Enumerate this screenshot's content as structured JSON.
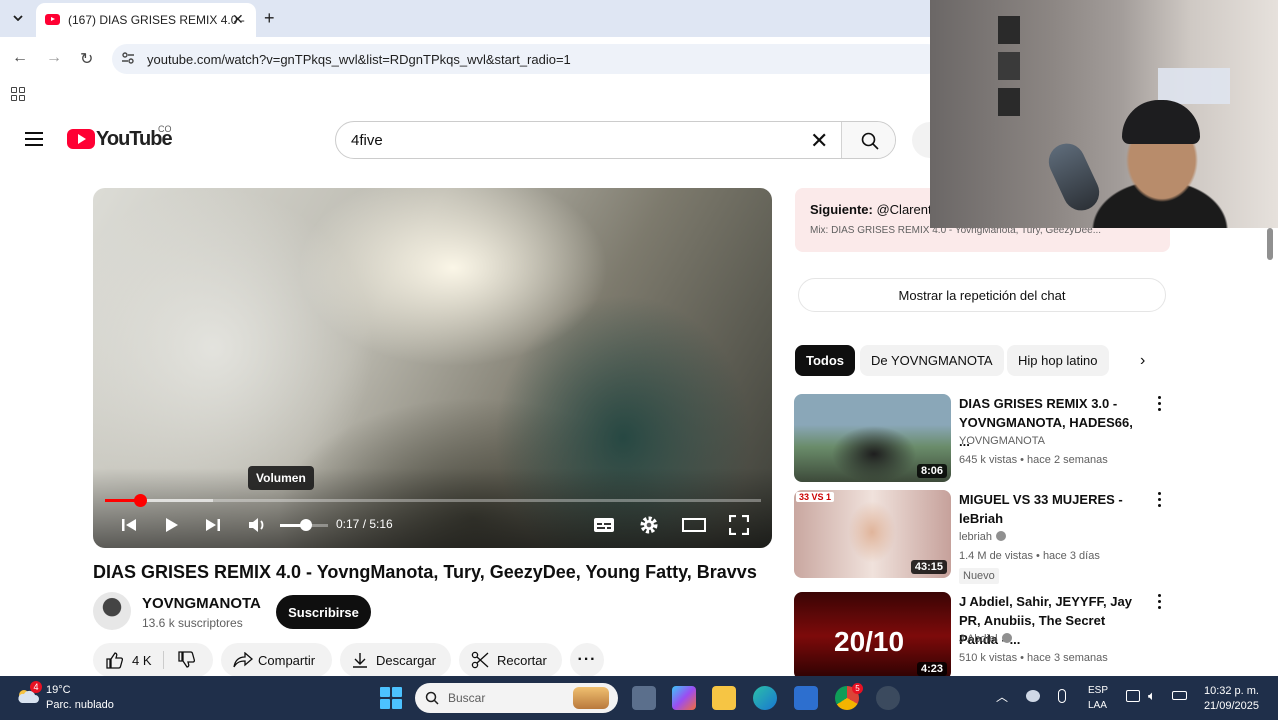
{
  "browser": {
    "tab_title": "(167) DIAS GRISES REMIX 4.0 -",
    "url": "youtube.com/watch?v=gnTPkqs_wvl&list=RDgnTPkqs_wvl&start_radio=1"
  },
  "youtube": {
    "logo_text": "YouTube",
    "country_code": "CO",
    "search_query": "4five"
  },
  "player": {
    "tooltip": "Volumen",
    "current_time": "0:17",
    "duration": "5:16",
    "time_display": "0:17 / 5:16",
    "progress_fraction": 0.054,
    "buffered_fraction": 0.165,
    "volume_fraction": 0.55
  },
  "video": {
    "title": "DIAS GRISES REMIX 4.0 - YovngManota, Tury, GeezyDee, Young Fatty, Bravvs",
    "channel_name": "YOVNGMANOTA",
    "subscribers": "13.6 k suscriptores",
    "subscribe_label": "Suscribirse",
    "likes": "4 K",
    "share_label": "Compartir",
    "download_label": "Descargar",
    "clip_label": "Recortar"
  },
  "sidebar": {
    "next_up_label": "Siguiente:",
    "next_up_channel": "@ClarentK",
    "next_up_mix": "Mix: DIAS GRISES REMIX 4.0 - YovngManota, Tury, GeezyDee...",
    "chat_replay_label": "Mostrar la repetición del chat",
    "chips": [
      "Todos",
      "De YOVNGMANOTA",
      "Hip hop latino"
    ],
    "recommendations": [
      {
        "title": "DIAS GRISES REMIX 3.0 - YOVNGMANOTA, HADES66, ...",
        "channel": "YOVNGMANOTA",
        "meta": "645 k vistas • hace 2 semanas",
        "duration": "8:06"
      },
      {
        "title": "MIGUEL VS 33 MUJERES - leBriah",
        "channel": "lebriah",
        "meta": "1.4 M de vistas • hace 3 días",
        "duration": "43:15",
        "badge": "Nuevo",
        "thumb_tag": "33 VS 1"
      },
      {
        "title": "J Abdiel, Sahir, JEYYFF, Jay PR, Anubiis, The Secret Panda - ...",
        "channel": "J Abdiel",
        "meta": "510 k vistas • hace 3 semanas",
        "duration": "4:23",
        "thumb_text": "20/10"
      }
    ]
  },
  "taskbar": {
    "weather_badge": "4",
    "temperature": "19°C",
    "condition": "Parc. nublado",
    "search_placeholder": "Buscar",
    "chrome_badge": "5",
    "lang_1": "ESP",
    "lang_2": "LAA",
    "time": "10:32 p. m.",
    "date": "21/09/2025"
  },
  "colors": {
    "youtube_red": "#ff0033",
    "progress_red": "#ff0000",
    "chip_active": "#0f0f0f",
    "next_up_bg": "#fbeaea",
    "taskbar_bg": "#1f2f4a"
  }
}
